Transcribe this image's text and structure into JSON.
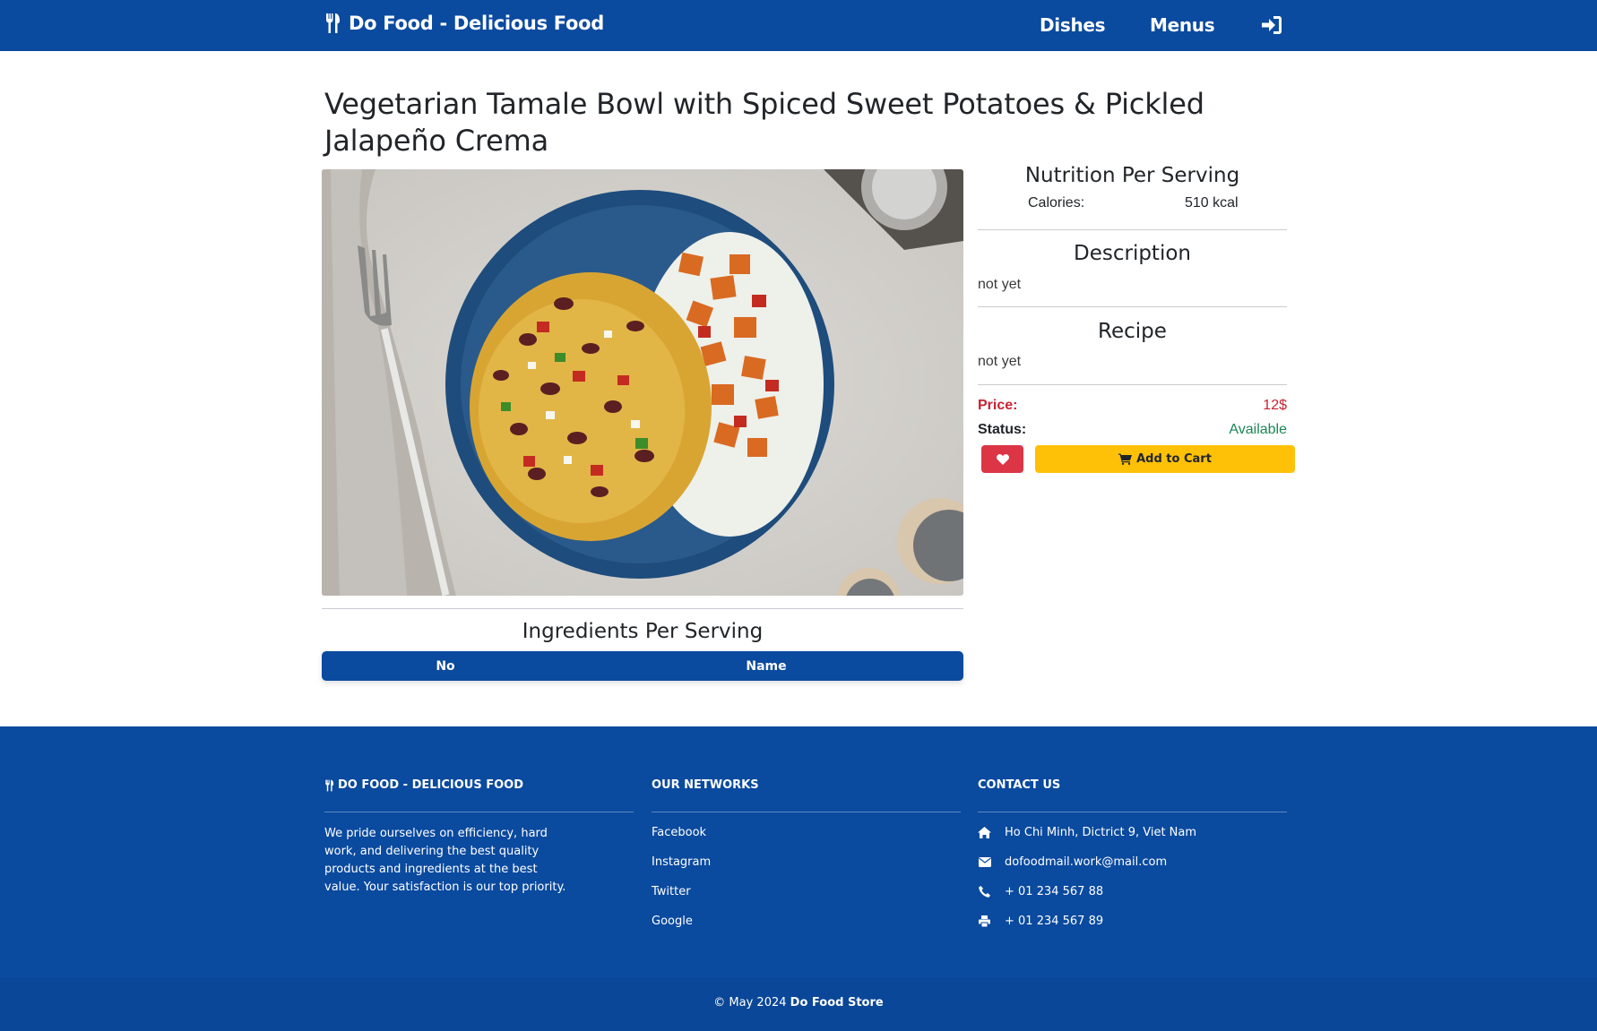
{
  "navbar": {
    "brand": "Do Food - Delicious Food",
    "links": [
      "Dishes",
      "Menus"
    ],
    "login_icon": "sign-in-icon",
    "brand_icon": "utensils-icon"
  },
  "dish": {
    "title": "Vegetarian Tamale Bowl with Spiced Sweet Potatoes & Pickled Jalapeño Crema",
    "image_alt": "food-photo"
  },
  "nutrition": {
    "title": "Nutrition Per Serving",
    "calories_label": "Calories:",
    "calories_value": "510 kcal"
  },
  "description": {
    "title": "Description",
    "text": "not yet"
  },
  "recipe": {
    "title": "Recipe",
    "text": "not yet"
  },
  "purchase": {
    "price_label": "Price:",
    "price_value": "12$",
    "status_label": "Status:",
    "status_value": "Available",
    "add_to_cart": "Add to Cart",
    "favorite_icon": "heart-icon",
    "cart_icon": "shopping-cart-icon"
  },
  "ingredients": {
    "title": "Ingredients Per Serving",
    "columns": [
      "No",
      "Name"
    ]
  },
  "footer": {
    "brand_heading": "DO FOOD - DELICIOUS FOOD",
    "about": "We pride ourselves on efficiency, hard work, and delivering the best quality products and ingredients at the best value. Your satisfaction is our top priority.",
    "networks_heading": "OUR NETWORKS",
    "networks": [
      "Facebook",
      "Instagram",
      "Twitter",
      "Google"
    ],
    "contact_heading": "CONTACT US",
    "contacts": [
      {
        "icon": "home-icon",
        "text": "Ho Chi Minh, Dictrict 9, Viet Nam"
      },
      {
        "icon": "envelope-icon",
        "text": "dofoodmail.work@mail.com"
      },
      {
        "icon": "phone-icon",
        "text": "+ 01 234 567 88"
      },
      {
        "icon": "print-icon",
        "text": "+ 01 234 567 89"
      }
    ],
    "copyright_prefix": "© May 2024",
    "copyright_store": "Do Food Store"
  },
  "colors": {
    "primary": "#0a4a9f",
    "danger": "#dc3545",
    "warning": "#ffc107",
    "success": "#198754"
  }
}
